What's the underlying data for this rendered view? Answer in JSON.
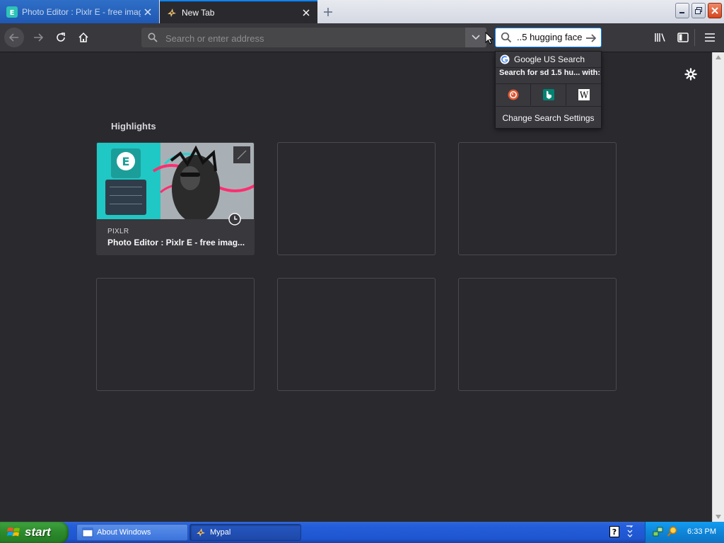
{
  "browser": {
    "tabs": [
      {
        "title": "Photo Editor : Pixlr E - free image",
        "active": false
      },
      {
        "title": "New Tab",
        "active": true
      }
    ],
    "urlbar": {
      "placeholder": "Search or enter address",
      "value": ""
    },
    "searchbar": {
      "value": "..5 hugging face"
    }
  },
  "search_popup": {
    "default_engine": "Google US Search",
    "search_for_label": "Search for sd 1.5 hu... with:",
    "engines": [
      "duckduckgo-icon",
      "bing-icon",
      "wikipedia-icon"
    ],
    "change_settings": "Change Search Settings"
  },
  "newtab": {
    "highlights_title": "Highlights",
    "cards": [
      {
        "host": "PIXLR",
        "title": "Photo Editor : Pixlr E - free imag..."
      }
    ]
  },
  "taskbar": {
    "start_label": "start",
    "tasks": [
      {
        "label": "About Windows"
      },
      {
        "label": "Mypal"
      }
    ],
    "clock": "6:33 PM"
  },
  "colors": {
    "accent": "#0a84ff",
    "page_bg": "#2a2a2e",
    "toolbar_bg": "#38383d",
    "taskbar": "#245edb",
    "start_green": "#2c8a2c"
  }
}
